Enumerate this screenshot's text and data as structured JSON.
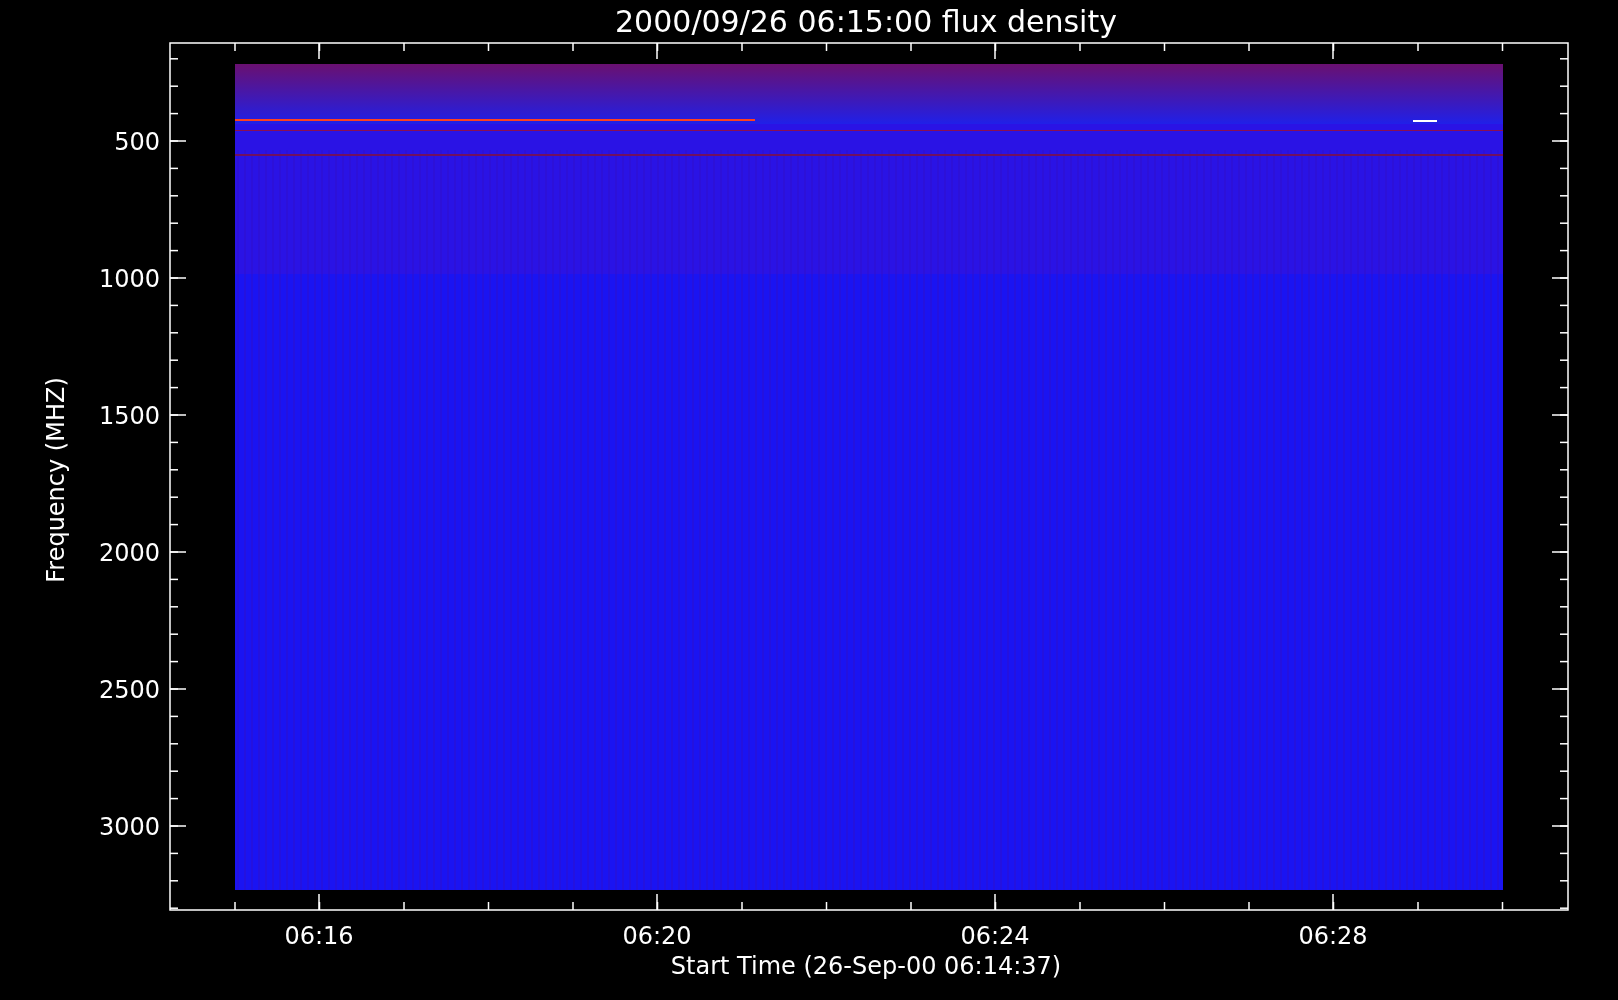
{
  "plot": {
    "title": "2000/09/26 06:15:00 flux density",
    "y_axis": {
      "label": "Frequency (MHZ)",
      "ticks": [
        "500",
        "1000",
        "1500",
        "2000",
        "2500",
        "3000"
      ]
    },
    "x_axis": {
      "label": "Start Time (26-Sep-00 06:14:37)",
      "ticks": [
        "06:16",
        "06:20",
        "06:24",
        "06:28"
      ]
    }
  }
}
